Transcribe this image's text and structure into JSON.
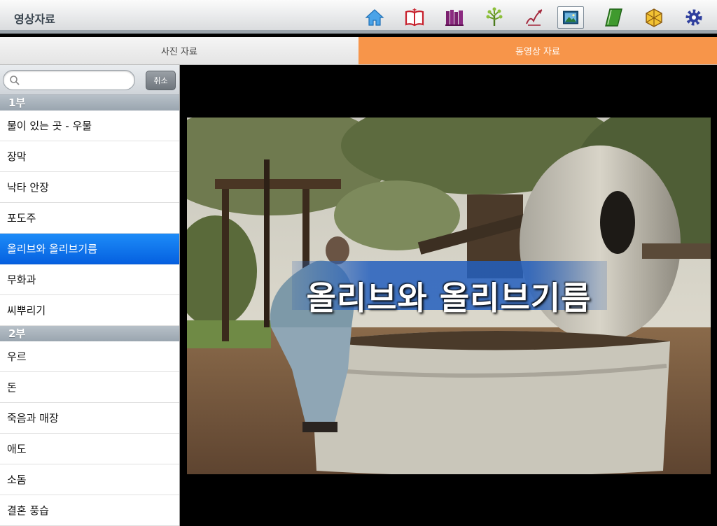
{
  "header": {
    "title": "영상자료",
    "toolbar_icons": [
      "home-icon",
      "bible-book-icon",
      "library-books-icon",
      "tree-icon",
      "pen-writing-icon",
      "media-gallery-icon",
      "green-book-icon",
      "gift-box-icon",
      "settings-gear-icon"
    ],
    "active_icon": "media-gallery-icon"
  },
  "tabs": [
    {
      "label": "사진 자료",
      "selected": false
    },
    {
      "label": "동영상 자료",
      "selected": true
    }
  ],
  "search": {
    "placeholder": "",
    "value": "",
    "cancel_label": "취소"
  },
  "sections": [
    {
      "title": "1부",
      "items": [
        {
          "label": "물이 있는 곳 - 우물"
        },
        {
          "label": "장막"
        },
        {
          "label": "낙타 안장"
        },
        {
          "label": "포도주"
        },
        {
          "label": "올리브와 올리브기름",
          "selected": true
        },
        {
          "label": "무화과"
        },
        {
          "label": "씨뿌리기"
        }
      ]
    },
    {
      "title": "2부",
      "items": [
        {
          "label": "우르"
        },
        {
          "label": "돈"
        },
        {
          "label": "죽음과 매장"
        },
        {
          "label": "애도"
        },
        {
          "label": "소돔"
        },
        {
          "label": "결혼 풍습"
        }
      ]
    }
  ],
  "video": {
    "caption": "올리브와 올리브기름"
  },
  "colors": {
    "tab_selected": "#f7954a",
    "row_selected": "#0a6ef0"
  }
}
